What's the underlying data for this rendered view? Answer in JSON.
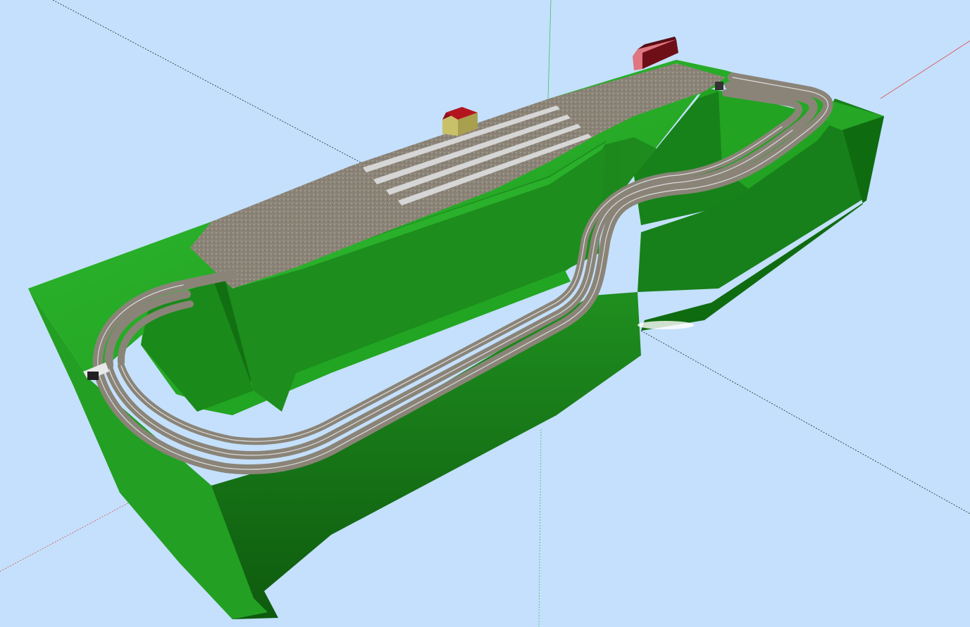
{
  "scene": {
    "background": "#c4e0fc",
    "axis_colors": {
      "red": "#e05050",
      "green": "#40c060",
      "blue": "#2040c0",
      "dark": "#202020"
    },
    "terrain": {
      "top": "#23a023",
      "top_light": "#2db82d",
      "wall": "#1c7f1c",
      "wall_dark": "#105c10",
      "wall_shadow": "#0b3f0b"
    },
    "track": {
      "ballast": "#8d8779",
      "rail": "#d8d8d8"
    },
    "platform": "#d6d6d6",
    "buildings": [
      {
        "type": "house-icon",
        "roof": "#a0151f",
        "wall": "#c9c06a"
      },
      {
        "type": "barn-icon",
        "roof": "#6e0f18",
        "wall": "#e07680"
      }
    ]
  }
}
